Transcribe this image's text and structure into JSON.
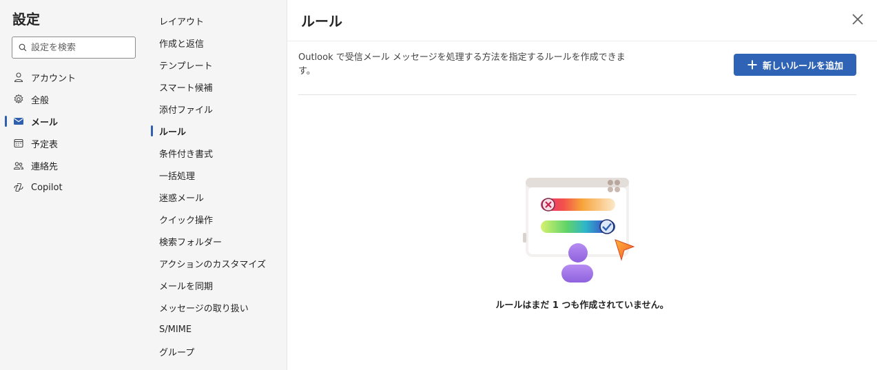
{
  "settings": {
    "title": "設定",
    "search_placeholder": "設定を検索",
    "nav": [
      {
        "label": "アカウント",
        "icon": "person-icon"
      },
      {
        "label": "全般",
        "icon": "gear-icon"
      },
      {
        "label": "メール",
        "icon": "mail-icon",
        "active": true
      },
      {
        "label": "予定表",
        "icon": "calendar-icon"
      },
      {
        "label": "連絡先",
        "icon": "people-icon"
      },
      {
        "label": "Copilot",
        "icon": "copilot-icon"
      }
    ]
  },
  "mail_sections": [
    {
      "label": "レイアウト"
    },
    {
      "label": "作成と返信"
    },
    {
      "label": "テンプレート"
    },
    {
      "label": "スマート候補"
    },
    {
      "label": "添付ファイル"
    },
    {
      "label": "ルール",
      "active": true
    },
    {
      "label": "条件付き書式"
    },
    {
      "label": "一括処理"
    },
    {
      "label": "迷惑メール"
    },
    {
      "label": "クイック操作"
    },
    {
      "label": "検索フォルダー"
    },
    {
      "label": "アクションのカスタマイズ"
    },
    {
      "label": "メールを同期"
    },
    {
      "label": "メッセージの取り扱い"
    },
    {
      "label": "S/MIME"
    },
    {
      "label": "グループ"
    }
  ],
  "rules": {
    "title": "ルール",
    "description": "Outlook で受信メール メッセージを処理する方法を指定するルールを作成できます。",
    "add_button": "新しいルールを追加",
    "empty_message": "ルールはまだ 1 つも作成されていません。"
  },
  "colors": {
    "accent": "#2f63b5",
    "active_indicator": "#2f5fad",
    "pane_bg": "#f5f5f5"
  }
}
